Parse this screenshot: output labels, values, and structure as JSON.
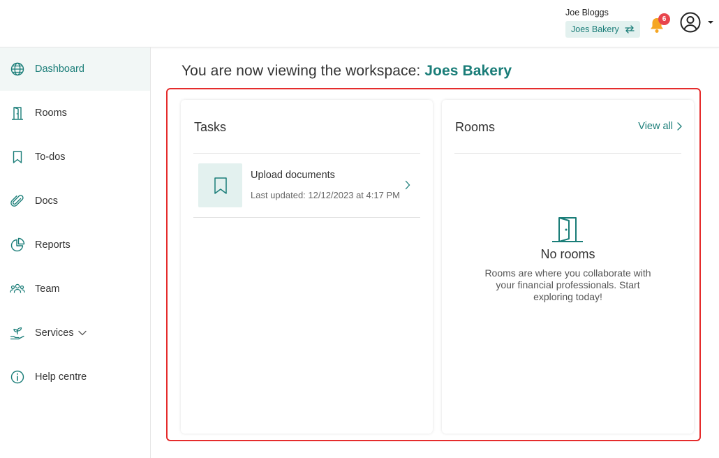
{
  "header": {
    "user_name": "Joe Bloggs",
    "workspace_label": "Joes Bakery",
    "notification_count": "6",
    "icons": [
      "switch-icon",
      "bell-icon",
      "user-avatar-icon",
      "caret-down-icon"
    ],
    "accent": "#1a7d78",
    "badge_color": "#e8454c"
  },
  "sidebar": {
    "items": [
      {
        "label": "Dashboard",
        "icon": "globe-icon",
        "active": true
      },
      {
        "label": "Rooms",
        "icon": "door-icon"
      },
      {
        "label": "To-dos",
        "icon": "bookmark-icon"
      },
      {
        "label": "Docs",
        "icon": "paperclip-icon"
      },
      {
        "label": "Reports",
        "icon": "pie-chart-icon"
      },
      {
        "label": "Team",
        "icon": "team-icon"
      },
      {
        "label": "Services",
        "icon": "plant-hand-icon",
        "has_submenu": true
      },
      {
        "label": "Help centre",
        "icon": "info-icon"
      }
    ]
  },
  "main": {
    "title_prefix": "You are now viewing the workspace:",
    "workspace_name": "Joes Bakery",
    "highlight_color": "#e52c2c",
    "tasks": {
      "title": "Tasks",
      "items": [
        {
          "name": "Upload documents",
          "meta": "Last updated: 12/12/2023 at 4:17 PM"
        }
      ]
    },
    "rooms": {
      "title": "Rooms",
      "view_all": "View all",
      "empty_title": "No rooms",
      "empty_desc": "Rooms are where you collaborate with your financial professionals. Start exploring today!"
    }
  }
}
